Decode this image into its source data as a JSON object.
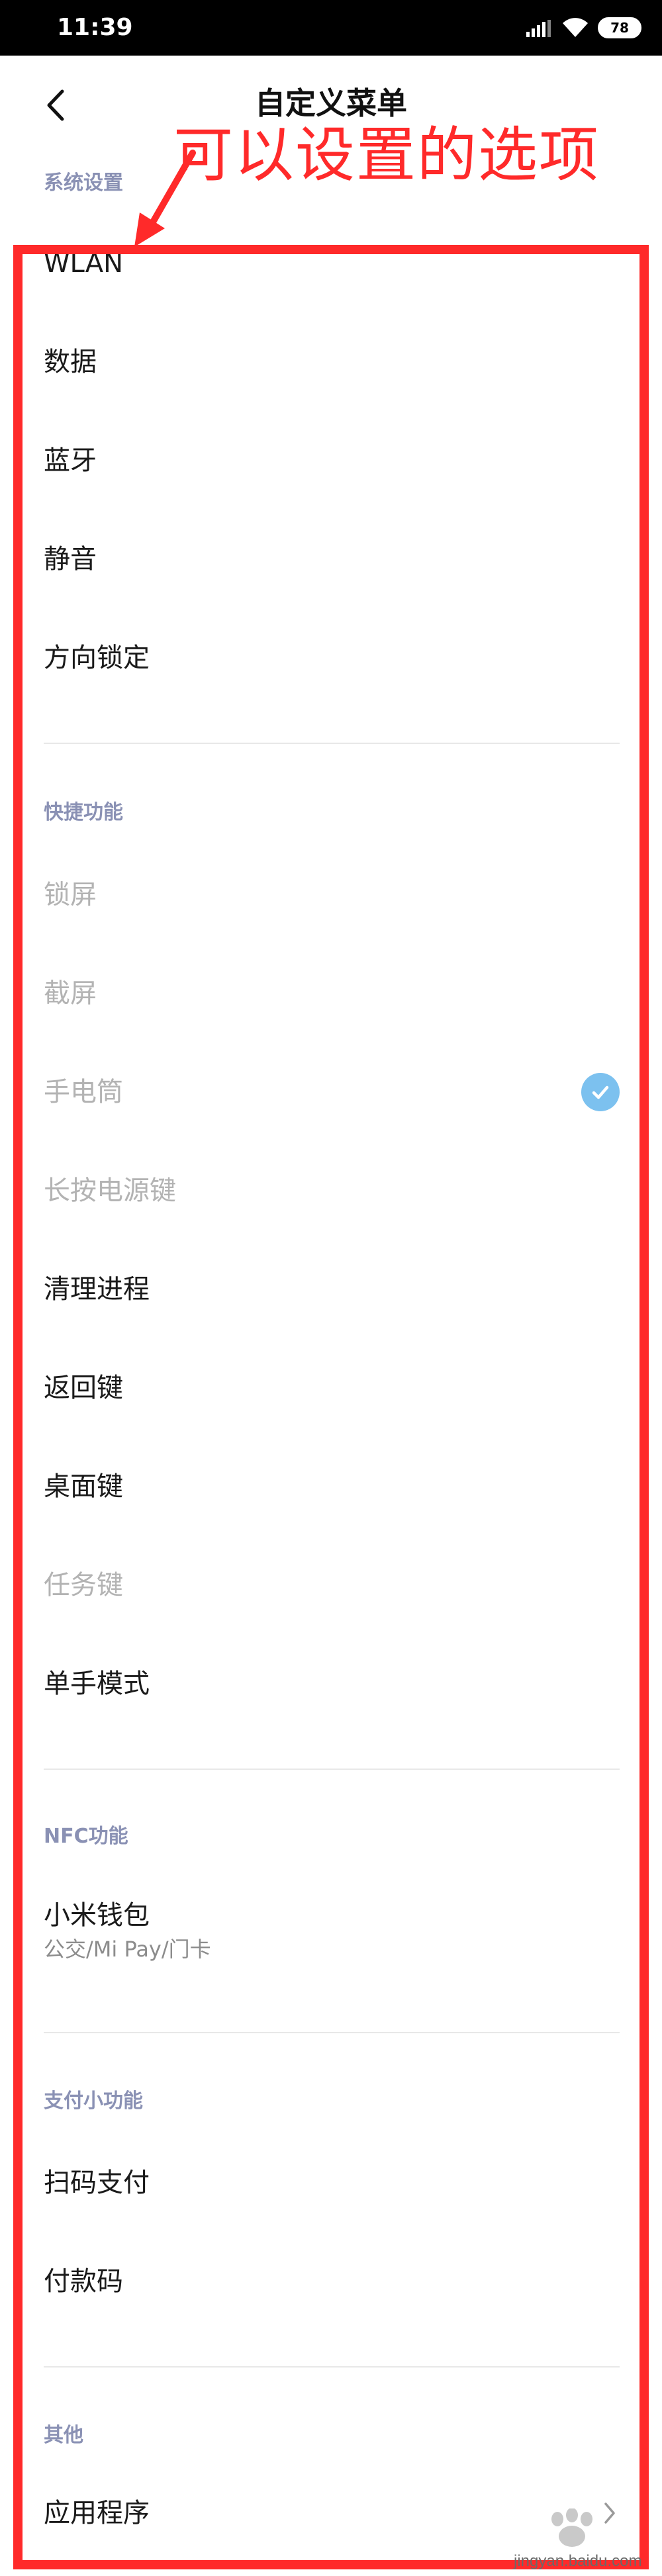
{
  "status_bar": {
    "time": "11:39",
    "battery": "78"
  },
  "header": {
    "title": "自定义菜单"
  },
  "annotation": {
    "text": "可以设置的选项"
  },
  "sections": {
    "system": {
      "title": "系统设置",
      "items": [
        {
          "label": "WLAN",
          "enabled": true
        },
        {
          "label": "数据",
          "enabled": true
        },
        {
          "label": "蓝牙",
          "enabled": true
        },
        {
          "label": "静音",
          "enabled": true
        },
        {
          "label": "方向锁定",
          "enabled": true
        }
      ]
    },
    "shortcuts": {
      "title": "快捷功能",
      "items": [
        {
          "label": "锁屏",
          "enabled": false
        },
        {
          "label": "截屏",
          "enabled": false
        },
        {
          "label": "手电筒",
          "enabled": false,
          "checked": true
        },
        {
          "label": "长按电源键",
          "enabled": false
        },
        {
          "label": "清理进程",
          "enabled": true
        },
        {
          "label": "返回键",
          "enabled": true
        },
        {
          "label": "桌面键",
          "enabled": true
        },
        {
          "label": "任务键",
          "enabled": false
        },
        {
          "label": "单手模式",
          "enabled": true
        }
      ]
    },
    "nfc": {
      "title": "NFC功能",
      "items": [
        {
          "label": "小米钱包",
          "sub": "公交/Mi Pay/门卡",
          "enabled": true
        }
      ]
    },
    "payment": {
      "title": "支付小功能",
      "items": [
        {
          "label": "扫码支付",
          "enabled": true
        },
        {
          "label": "付款码",
          "enabled": true
        }
      ]
    },
    "other": {
      "title": "其他",
      "items": [
        {
          "label": "应用程序",
          "enabled": true
        }
      ]
    }
  },
  "watermark": {
    "text": "jingyan.baidu.com"
  },
  "colors": {
    "annotation": "#ff2a2a",
    "section_title": "#8a91b4",
    "check": "#7cc1ef",
    "disabled_text": "#b3b3b3"
  }
}
